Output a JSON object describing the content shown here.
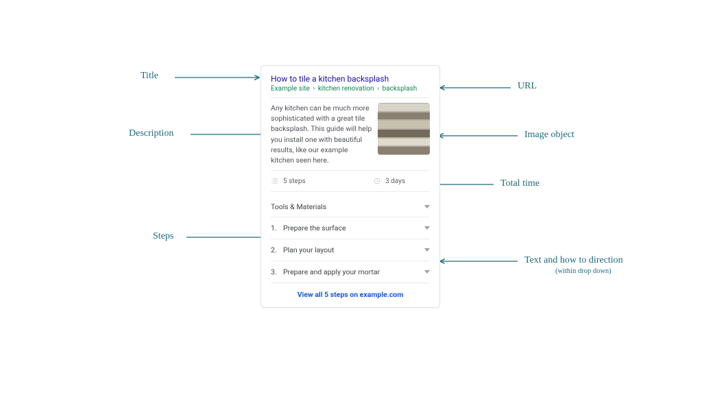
{
  "card": {
    "title": "How to tile a kitchen backsplash",
    "breadcrumb": [
      "Example site",
      "kitchen renovation",
      "backsplash"
    ],
    "description": "Any kitchen can be much more sophisticated with a great tile backsplash. This guide will help you install one with beautiful results, like our example kitchen seen here.",
    "steps_count": "5 steps",
    "duration": "3 days",
    "tools_section": "Tools & Materials",
    "steps": [
      {
        "n": "1.",
        "label": "Prepare the surface"
      },
      {
        "n": "2.",
        "label": "Plan your layout"
      },
      {
        "n": "3.",
        "label": "Prepare and apply your mortar"
      }
    ],
    "view_all": "View all 5 steps on example.com"
  },
  "annotations": {
    "title": "Title",
    "url": "URL",
    "description": "Description",
    "image": "Image object",
    "total_time": "Total time",
    "steps": "Steps",
    "howto": "Text and how to direction",
    "howto_sub": "(within drop down)"
  }
}
